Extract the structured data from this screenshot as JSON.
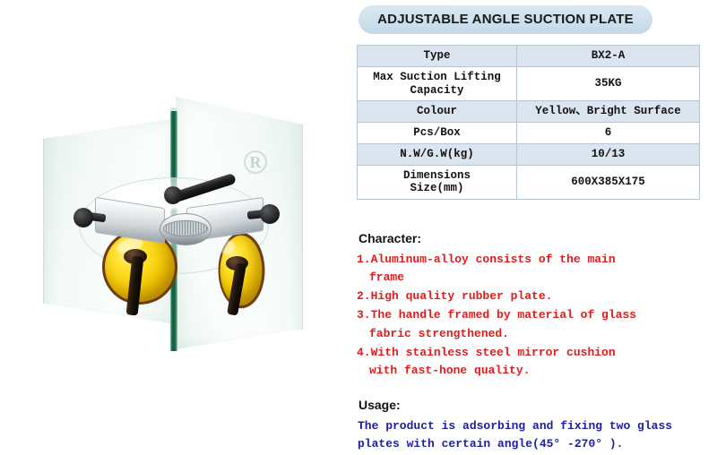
{
  "header": {
    "title": "ADJUSTABLE ANGLE SUCTION PLATE"
  },
  "spec_table": {
    "rows": [
      {
        "label": "Type",
        "value": "BX2-A"
      },
      {
        "label": "Max Suction Lifting\nCapacity",
        "value": "35KG"
      },
      {
        "label": "Colour",
        "value": "Yellow、Bright Surface"
      },
      {
        "label": "Pcs/Box",
        "value": "6"
      },
      {
        "label": "N.W/G.W(kg)",
        "value": "10/13"
      },
      {
        "label": "Dimensions\nSize(mm)",
        "value": "600X385X175"
      }
    ]
  },
  "character": {
    "heading": "Character:",
    "items": [
      "1.Aluminum-alloy consists of the main\n frame",
      "2.High quality rubber plate.",
      "3.The handle framed by material of glass\n fabric strengthened.",
      "4.With stainless steel mirror cushion\n with fast-hone quality."
    ]
  },
  "usage": {
    "heading": "Usage:",
    "body": "The product is adsorbing and fixing two glass\nplates with certain angle(45° -270° )."
  },
  "photo": {
    "watermark": "R"
  },
  "colors": {
    "title_pill": "#cfe1ed",
    "table_shade": "#dbe5ef",
    "table_border": "#b9c6d2",
    "character_text": "#e01b1b",
    "usage_text": "#1f1f9e",
    "cup_yellow": "#f5c800",
    "glass_edge_green": "#0f5c3e"
  }
}
